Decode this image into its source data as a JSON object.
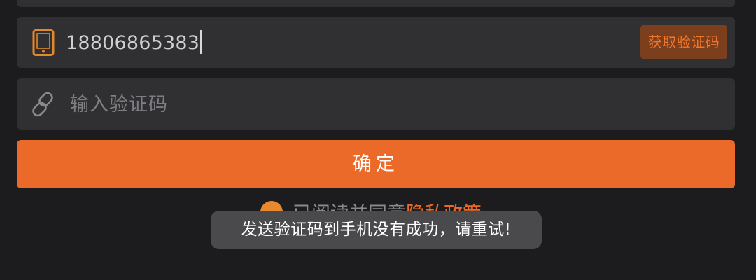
{
  "phone_field": {
    "value": "18806865383",
    "icon": "phone-icon",
    "get_code_label": "获取验证码"
  },
  "code_field": {
    "placeholder": "输入验证码",
    "icon": "link-icon"
  },
  "confirm_button": {
    "label": "确定"
  },
  "agreement": {
    "prefix": "已阅读并同意",
    "link": "隐私政策",
    "checked": true
  },
  "toast": {
    "message": "发送验证码到手机没有成功，请重试!"
  },
  "colors": {
    "accent": "#ec6a29",
    "field_bg": "#303032",
    "page_bg": "#1c1c1e"
  }
}
